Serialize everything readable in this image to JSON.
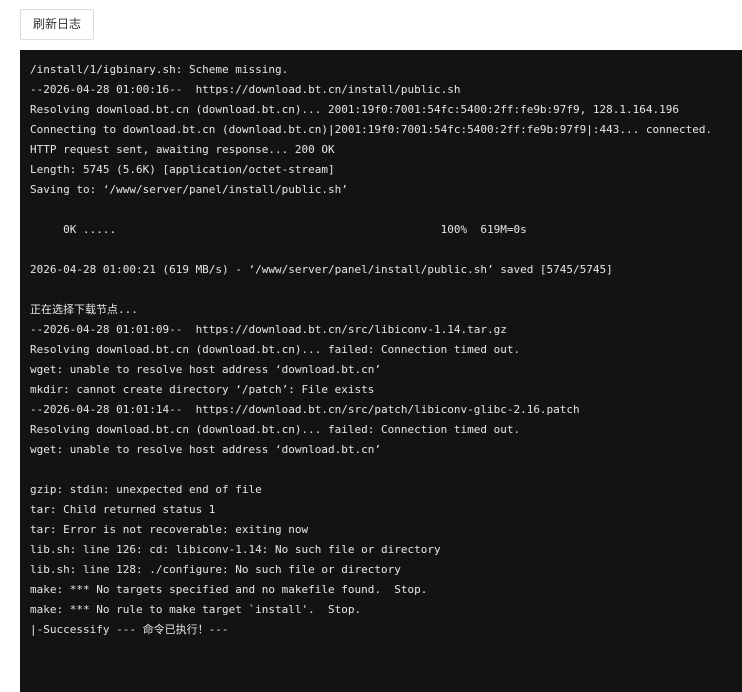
{
  "toolbar": {
    "refresh_label": "刷新日志"
  },
  "log": {
    "lines": [
      "/install/1/igbinary.sh: Scheme missing.",
      "--2026-04-28 01:00:16--  https://download.bt.cn/install/public.sh",
      "Resolving download.bt.cn (download.bt.cn)... 2001:19f0:7001:54fc:5400:2ff:fe9b:97f9, 128.1.164.196",
      "Connecting to download.bt.cn (download.bt.cn)|2001:19f0:7001:54fc:5400:2ff:fe9b:97f9|:443... connected.",
      "HTTP request sent, awaiting response... 200 OK",
      "Length: 5745 (5.6K) [application/octet-stream]",
      "Saving to: ‘/www/server/panel/install/public.sh’",
      "",
      "     0K .....                                                 100%  619M=0s",
      "",
      "2026-04-28 01:00:21 (619 MB/s) - ‘/www/server/panel/install/public.sh’ saved [5745/5745]",
      "",
      "正在选择下载节点...",
      "--2026-04-28 01:01:09--  https://download.bt.cn/src/libiconv-1.14.tar.gz",
      "Resolving download.bt.cn (download.bt.cn)... failed: Connection timed out.",
      "wget: unable to resolve host address ‘download.bt.cn’",
      "mkdir: cannot create directory ‘/patch’: File exists",
      "--2026-04-28 01:01:14--  https://download.bt.cn/src/patch/libiconv-glibc-2.16.patch",
      "Resolving download.bt.cn (download.bt.cn)... failed: Connection timed out.",
      "wget: unable to resolve host address ‘download.bt.cn’",
      "",
      "gzip: stdin: unexpected end of file",
      "tar: Child returned status 1",
      "tar: Error is not recoverable: exiting now",
      "lib.sh: line 126: cd: libiconv-1.14: No such file or directory",
      "lib.sh: line 128: ./configure: No such file or directory",
      "make: *** No targets specified and no makefile found.  Stop.",
      "make: *** No rule to make target `install'.  Stop.",
      "|-Successify --- 命令已执行！---"
    ]
  }
}
